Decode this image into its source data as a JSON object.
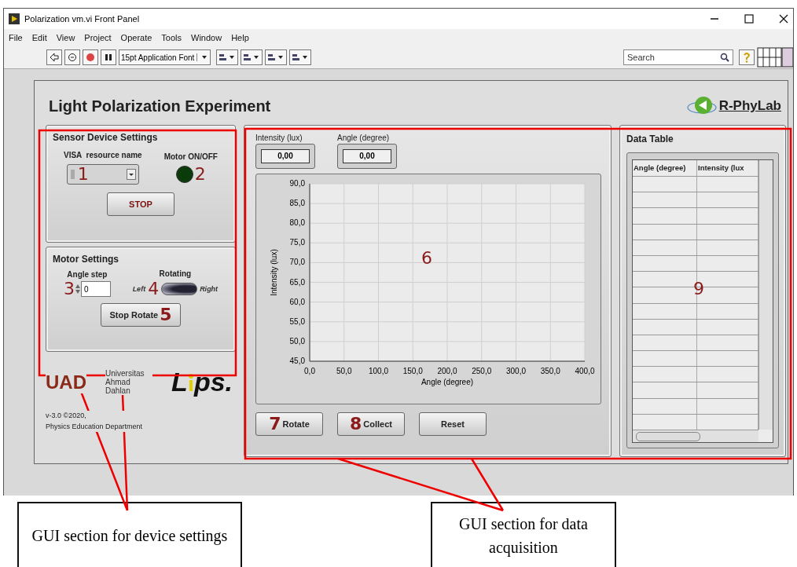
{
  "window": {
    "title": "Polarization vm.vi Front Panel"
  },
  "menu": [
    "File",
    "Edit",
    "View",
    "Project",
    "Operate",
    "Tools",
    "Window",
    "Help"
  ],
  "toolbar": {
    "font": "15pt Application Font",
    "search": {
      "placeholder": "Search"
    }
  },
  "panel": {
    "title": "Light Polarization Experiment",
    "logo": "R-PhyLab"
  },
  "sensor": {
    "title": "Sensor Device Settings",
    "visa": {
      "label": "VISA  resource name",
      "marker": "1"
    },
    "led": {
      "label": "Motor ON/OFF",
      "on": false,
      "marker": "2"
    },
    "stop": "STOP"
  },
  "motor": {
    "title": "Motor Settings",
    "angle_step": {
      "label": "Angle step",
      "value": "0",
      "marker": "3"
    },
    "rotating": {
      "label": "Rotating",
      "left": "Left",
      "right": "Right",
      "on": true,
      "marker": "4"
    },
    "stop_rotate": {
      "label": "Stop Rotate",
      "marker": "5"
    }
  },
  "branding": {
    "uad": "UAD",
    "uad_name": "Universitas Ahmad Dahlan",
    "lips": [
      "L",
      "ps."
    ],
    "version": "v-3.0 ©2020,",
    "department": "Physics Education Department"
  },
  "acquisition": {
    "indicators": [
      {
        "label": "Intensity (lux)",
        "value": "0,00"
      },
      {
        "label": "Angle (degree)",
        "value": "0,00"
      }
    ],
    "chart": {
      "marker": "6",
      "chart_data": {
        "type": "line",
        "grid": true,
        "xlabel": "Angle (degree)",
        "ylabel": "Intensity (lux)",
        "xlim": [
          0,
          400
        ],
        "ylim": [
          45,
          90
        ],
        "xticks": [
          {
            "value": 0,
            "label": "0,0"
          },
          {
            "value": 50,
            "label": "50,0"
          },
          {
            "value": 100,
            "label": "100,0"
          },
          {
            "value": 150,
            "label": "150,0"
          },
          {
            "value": 200,
            "label": "200,0"
          },
          {
            "value": 250,
            "label": "250,0"
          },
          {
            "value": 300,
            "label": "300,0"
          },
          {
            "value": 350,
            "label": "350,0"
          },
          {
            "value": 400,
            "label": "400,0"
          }
        ],
        "yticks": [
          {
            "value": 45,
            "label": "45,0"
          },
          {
            "value": 50,
            "label": "50,0"
          },
          {
            "value": 55,
            "label": "55,0"
          },
          {
            "value": 60,
            "label": "60,0"
          },
          {
            "value": 65,
            "label": "65,0"
          },
          {
            "value": 70,
            "label": "70,0"
          },
          {
            "value": 75,
            "label": "75,0"
          },
          {
            "value": 80,
            "label": "80,0"
          },
          {
            "value": 85,
            "label": "85,0"
          },
          {
            "value": 90,
            "label": "90,0"
          }
        ]
      }
    },
    "buttons": [
      {
        "label": "Rotate",
        "marker": "7"
      },
      {
        "label": "Collect",
        "marker": "8"
      },
      {
        "label": "Reset"
      }
    ]
  },
  "data_table": {
    "title": "Data Table",
    "columns": [
      "Angle (degree)",
      "Intensity (lux"
    ],
    "marker": "9"
  },
  "callouts": [
    "GUI section for device settings",
    "GUI section for data acquisition"
  ]
}
